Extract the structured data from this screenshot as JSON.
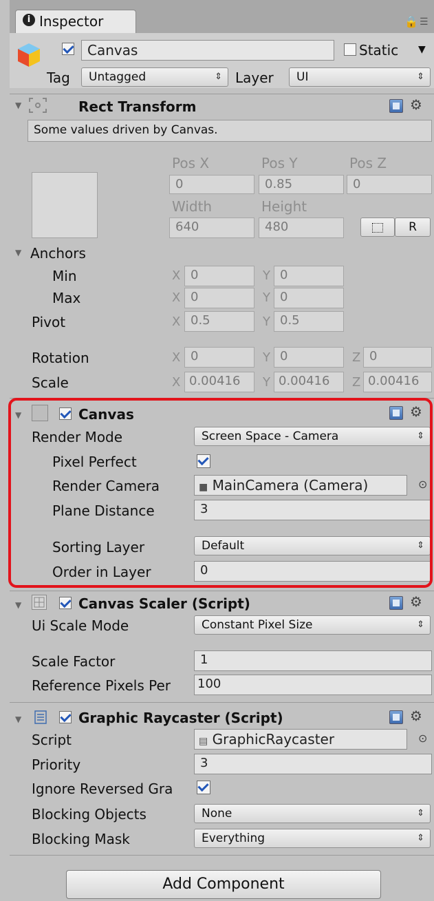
{
  "window": {
    "tab_title": "Inspector"
  },
  "header": {
    "object_name": "Canvas",
    "static_label": "Static",
    "tag_label": "Tag",
    "tag_value": "Untagged",
    "layer_label": "Layer",
    "layer_value": "UI"
  },
  "rect_transform": {
    "title": "Rect Transform",
    "notice": "Some values driven by Canvas.",
    "pos_x_label": "Pos X",
    "pos_y_label": "Pos Y",
    "pos_z_label": "Pos Z",
    "pos_x": "0",
    "pos_y": "0.85",
    "pos_z": "0",
    "width_label": "Width",
    "height_label": "Height",
    "width": "640",
    "height": "480",
    "r_button": "R",
    "anchors_label": "Anchors",
    "min_label": "Min",
    "max_label": "Max",
    "min_x": "0",
    "min_y": "0",
    "max_x": "0",
    "max_y": "0",
    "pivot_label": "Pivot",
    "pivot_x": "0.5",
    "pivot_y": "0.5",
    "rotation_label": "Rotation",
    "rot_x": "0",
    "rot_y": "0",
    "rot_z": "0",
    "scale_label": "Scale",
    "scale_x": "0.00416",
    "scale_y": "0.00416",
    "scale_z": "0.00416",
    "x": "X",
    "y": "Y",
    "z": "Z"
  },
  "canvas": {
    "title": "Canvas",
    "render_mode_label": "Render Mode",
    "render_mode_value": "Screen Space - Camera",
    "pixel_perfect_label": "Pixel Perfect",
    "render_camera_label": "Render Camera",
    "render_camera_value": "MainCamera (Camera)",
    "plane_distance_label": "Plane Distance",
    "plane_distance_value": "3",
    "sorting_layer_label": "Sorting Layer",
    "sorting_layer_value": "Default",
    "order_label": "Order in Layer",
    "order_value": "0"
  },
  "canvas_scaler": {
    "title": "Canvas Scaler (Script)",
    "ui_scale_label": "Ui Scale Mode",
    "ui_scale_value": "Constant Pixel Size",
    "scale_factor_label": "Scale Factor",
    "scale_factor_value": "1",
    "ref_pixels_label": "Reference Pixels Per",
    "ref_pixels_value": "100"
  },
  "graphic_raycaster": {
    "title": "Graphic Raycaster (Script)",
    "script_label": "Script",
    "script_value": "GraphicRaycaster",
    "priority_label": "Priority",
    "priority_value": "3",
    "ignore_label": "Ignore Reversed Gra",
    "blocking_objects_label": "Blocking Objects",
    "blocking_objects_value": "None",
    "blocking_mask_label": "Blocking Mask",
    "blocking_mask_value": "Everything"
  },
  "footer": {
    "add_component": "Add Component"
  },
  "colors": {
    "highlight": "#e2141c",
    "panel": "#c2c2c2",
    "tab": "#e8e8e8"
  }
}
